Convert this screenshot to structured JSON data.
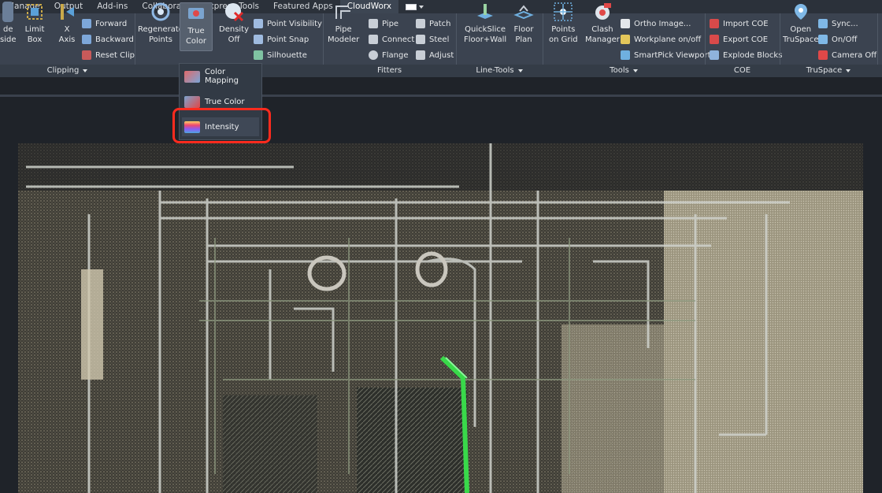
{
  "tabs": [
    {
      "label": "Manage",
      "active": false
    },
    {
      "label": "Output",
      "active": false
    },
    {
      "label": "Add-ins",
      "active": false
    },
    {
      "label": "Collaborate",
      "active": false
    },
    {
      "label": "Express Tools",
      "active": false
    },
    {
      "label": "Featured Apps",
      "active": false
    },
    {
      "label": "CloudWorx",
      "active": true
    }
  ],
  "clipping": {
    "partial_label": "de\nside",
    "limit_box": "Limit\nBox",
    "x_axis": "X\nAxis",
    "forward": "Forward",
    "backward": "Backward",
    "reset_clip": "Reset Clip",
    "panel": "Clipping"
  },
  "points": {
    "regenerate": "Regenerate\nPoints",
    "true_color": "True\nColor",
    "density_off": "Density\nOff",
    "point_visibility": "Point Visibility",
    "point_snap": "Point Snap",
    "silhouette": "Silhouette"
  },
  "fitters": {
    "pipe_modeler": "Pipe\nModeler",
    "pipe": "Pipe",
    "connect": "Connect",
    "flange": "Flange",
    "patch": "Patch",
    "steel": "Steel",
    "adjust": "Adjust",
    "panel": "Fitters"
  },
  "line_tools": {
    "quickslice": "QuickSlice\nFloor+Wall",
    "floor_plan": "Floor\nPlan",
    "panel": "Line-Tools"
  },
  "tools": {
    "points_on_grid": "Points\non Grid",
    "clash_manager": "Clash\nManager",
    "ortho_image": "Ortho Image...",
    "workplane": "Workplane on/off",
    "smartpick": "SmartPick Viewport",
    "panel": "Tools"
  },
  "coe": {
    "import": "Import COE",
    "export": "Export COE",
    "explode": "Explode Blocks",
    "panel": "COE"
  },
  "truspace": {
    "open": "Open\nTruSpace",
    "sync": "Sync...",
    "onoff": "On/Off",
    "camera_off": "Camera Off",
    "panel": "TruSpace"
  },
  "color_menu": {
    "items": [
      "Color Mapping",
      "True Color",
      "Intensity"
    ],
    "highlighted": "Intensity"
  },
  "colors": {
    "tabbar": "#2b313a",
    "ribbon": "#3b4350",
    "highlight_box": "#ff2b1e",
    "highlighted_pipe": "#39d94a"
  }
}
